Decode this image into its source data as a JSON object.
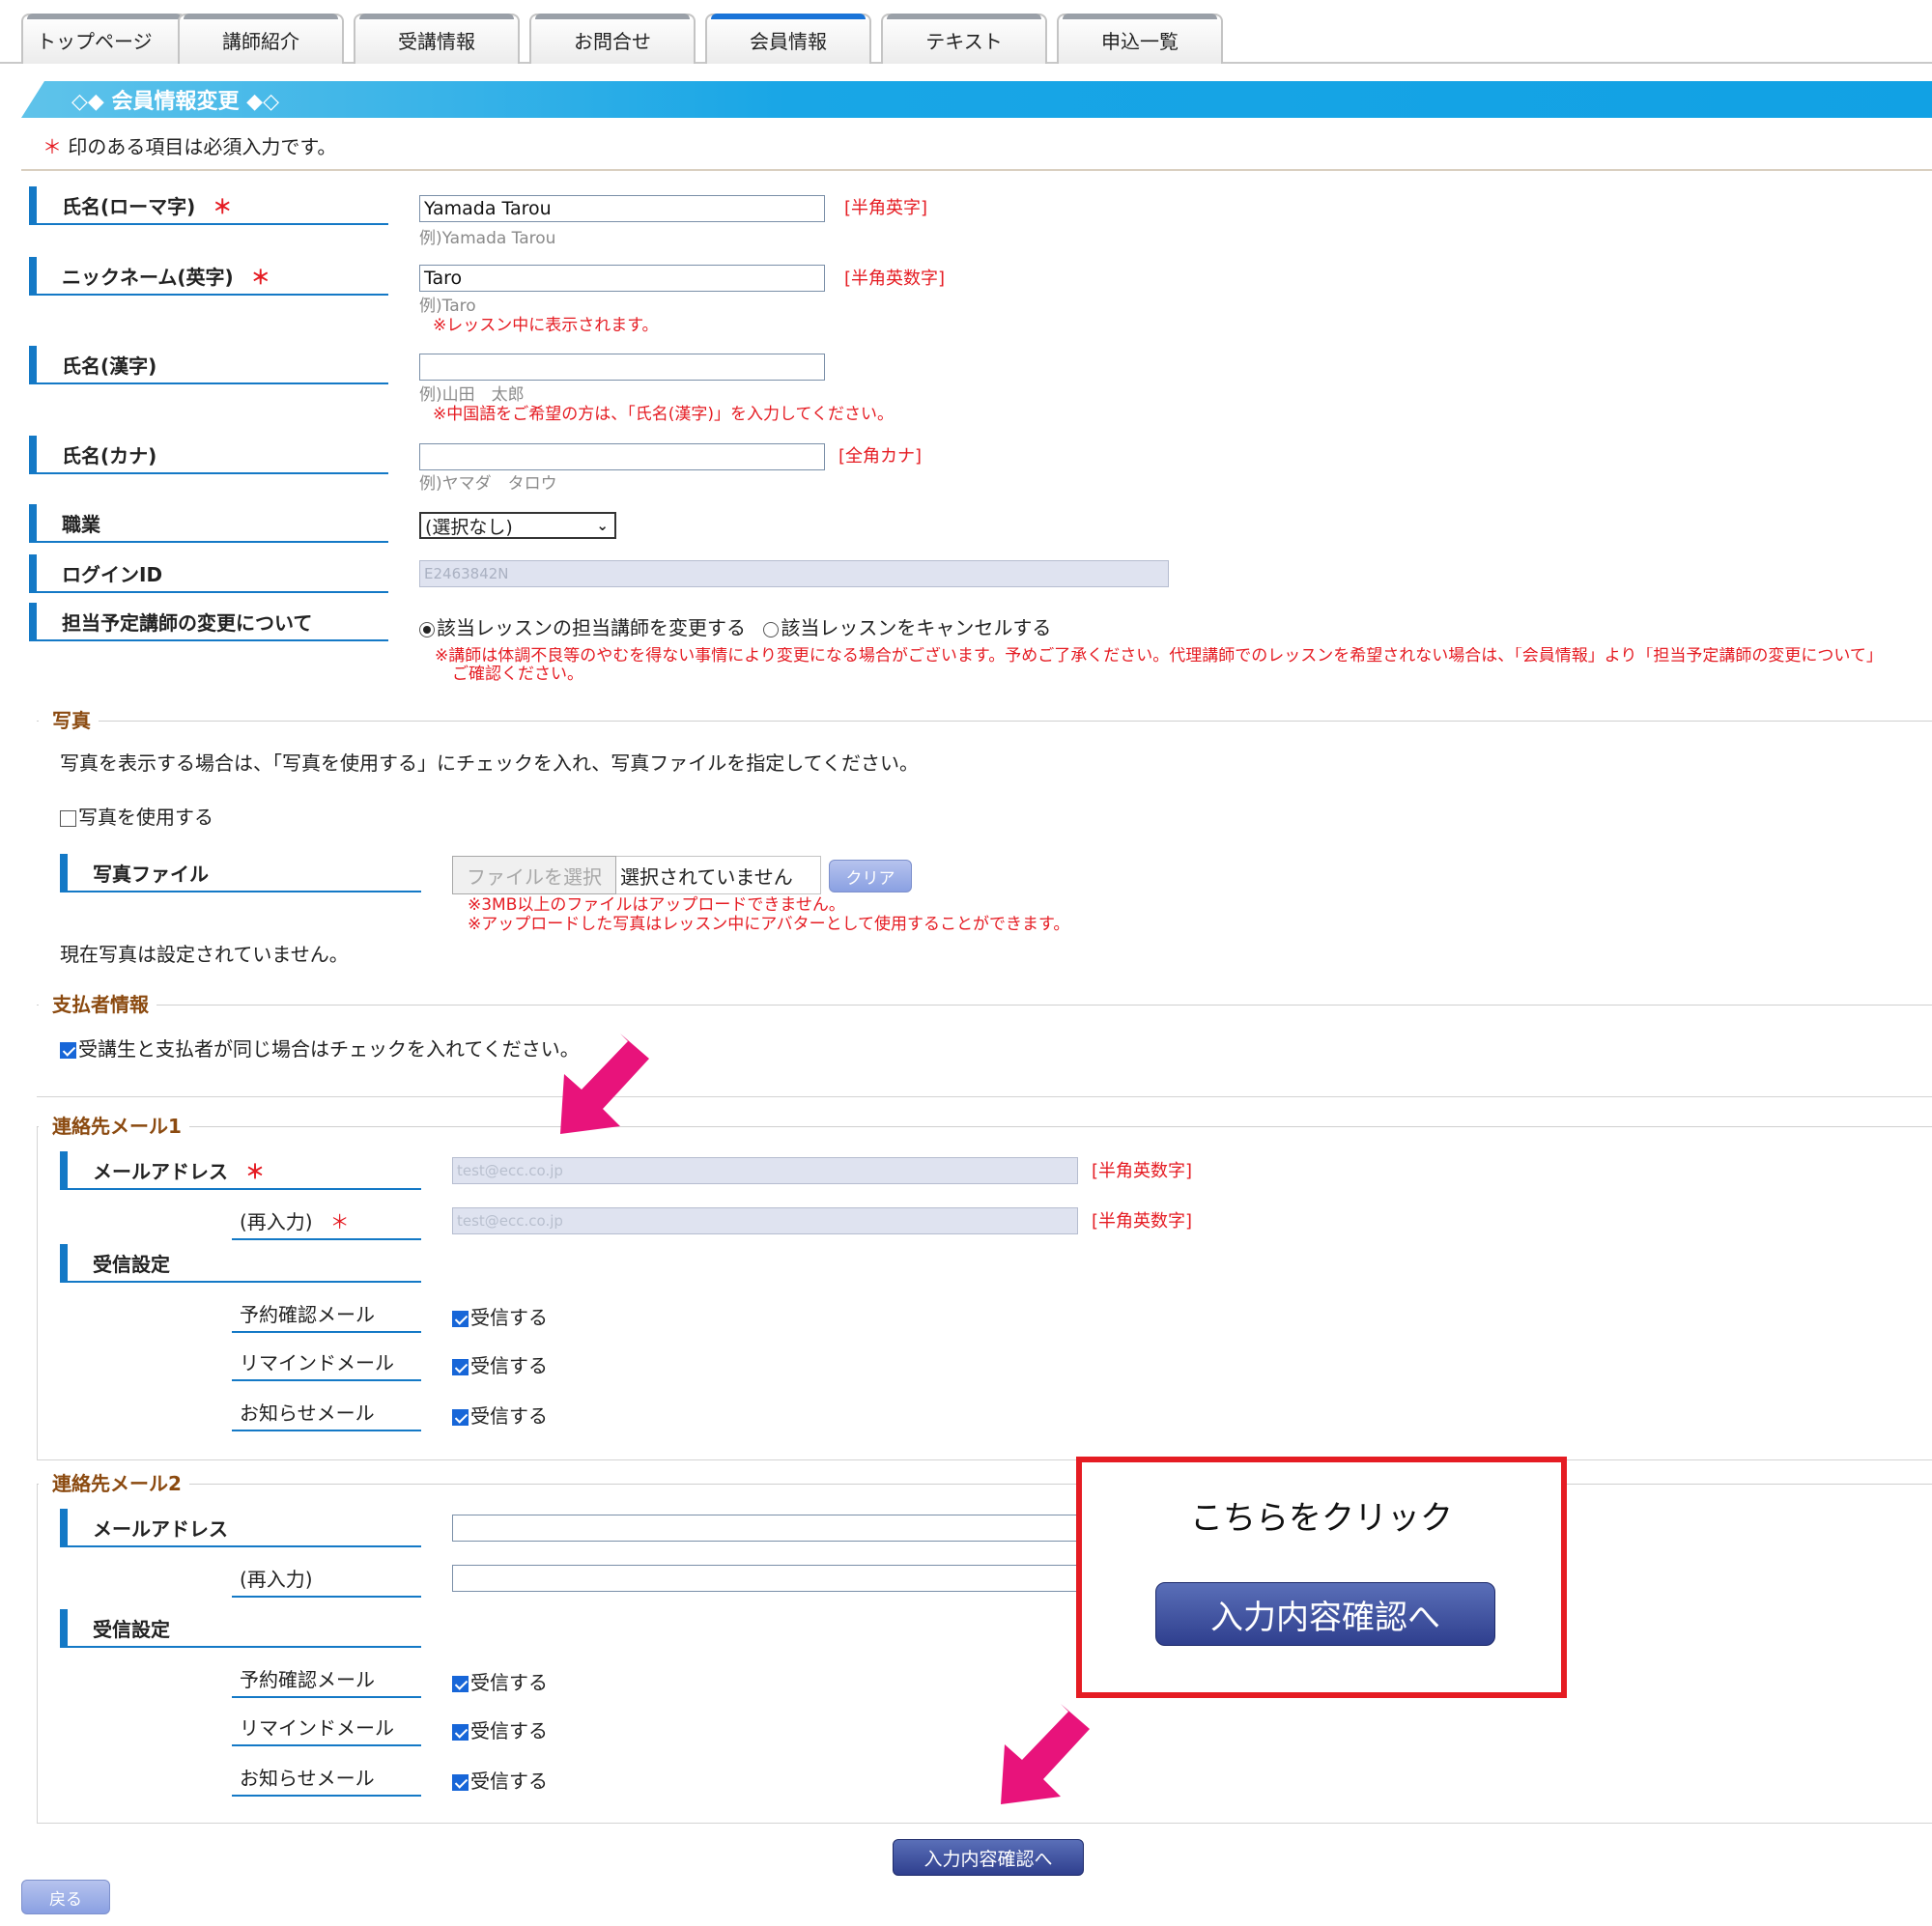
{
  "tabs": [
    {
      "label": "トップページ"
    },
    {
      "label": "講師紹介"
    },
    {
      "label": "受講情報"
    },
    {
      "label": "お問合せ"
    },
    {
      "label": "会員情報"
    },
    {
      "label": "テキスト"
    },
    {
      "label": "申込一覧"
    }
  ],
  "page_title": "◇◆ 会員情報変更 ◆◇",
  "required_note": {
    "mark": "＊",
    "text": "印のある項目は必須入力です。"
  },
  "fields": {
    "name_roman": {
      "label": "氏名(ローマ字)",
      "value": "Yamada Tarou",
      "hint": "[半角英字]",
      "example": "例)Yamada Tarou"
    },
    "nickname": {
      "label": "ニックネーム(英字)",
      "value": "Taro",
      "hint": "[半角英数字]",
      "example": "例)Taro",
      "note": "※レッスン中に表示されます。"
    },
    "name_kanji": {
      "label": "氏名(漢字)",
      "value": "",
      "example": "例)山田　太郎",
      "note": "※中国語をご希望の方は、「氏名(漢字)」を入力してください。"
    },
    "name_kana": {
      "label": "氏名(カナ)",
      "value": "",
      "hint": "[全角カナ]",
      "example": "例)ヤマダ　タロウ"
    },
    "occupation": {
      "label": "職業",
      "selected": "(選択なし)"
    },
    "login_id": {
      "label": "ログインID",
      "value": "E2463842N"
    },
    "teacher_change": {
      "label": "担当予定講師の変更について",
      "option1": "該当レッスンの担当講師を変更する",
      "option2": "該当レッスンをキャンセルする",
      "note_line1": "※講師は体調不良等のやむを得ない事情により変更になる場合がございます。予めご了承ください。代理講師でのレッスンを希望されない場合は、「会員情報」より「担当予定講師の変更について」",
      "note_line2": "ご確認ください。"
    }
  },
  "photo": {
    "legend": "写真",
    "instruction": "写真を表示する場合は、「写真を使用する」にチェックを入れ、写真ファイルを指定してください。",
    "use_photo_label": "写真を使用する",
    "file_label": "写真ファイル",
    "choose_file": "ファイルを選択",
    "no_file": "選択されていません",
    "clear": "クリア",
    "note1": "※3MB以上のファイルはアップロードできません。",
    "note2": "※アップロードした写真はレッスン中にアバターとして使用することができます。",
    "current": "現在写真は設定されていません。"
  },
  "payer": {
    "legend": "支払者情報",
    "same_label": "受講生と支払者が同じ場合はチェックを入れてください。"
  },
  "email1": {
    "legend": "連絡先メール1",
    "address_label": "メールアドレス",
    "reenter_label": "(再入力)",
    "placeholder": "test@ecc.co.jp",
    "hint": "[半角英数字]",
    "receive_label": "受信設定",
    "rows": [
      {
        "label": "予約確認メール",
        "check": "受信する"
      },
      {
        "label": "リマインドメール",
        "check": "受信する"
      },
      {
        "label": "お知らせメール",
        "check": "受信する"
      }
    ]
  },
  "email2": {
    "legend": "連絡先メール2",
    "address_label": "メールアドレス",
    "reenter_label": "(再入力)",
    "receive_label": "受信設定",
    "rows": [
      {
        "label": "予約確認メール",
        "check": "受信する"
      },
      {
        "label": "リマインドメール",
        "check": "受信する"
      },
      {
        "label": "お知らせメール",
        "check": "受信する"
      }
    ]
  },
  "callout": {
    "text": "こちらをクリック",
    "button": "入力内容確認へ"
  },
  "confirm_button": "入力内容確認へ",
  "back_button": "戻る",
  "colors": {
    "accent_blue": "#1479c6",
    "title_blue": "#19a6e6",
    "required_red": "#e51c23",
    "arrow_pink": "#e8137b",
    "legend_brown": "#8b4a10"
  }
}
